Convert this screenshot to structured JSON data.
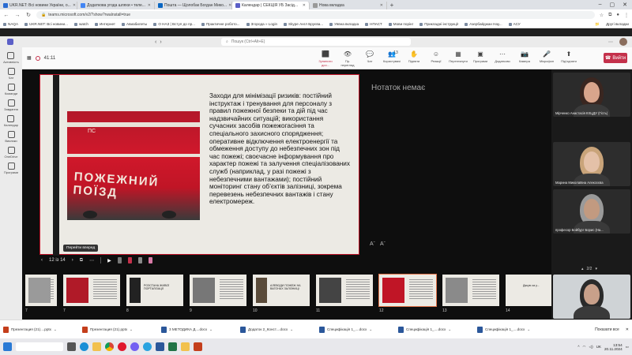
{
  "browser": {
    "tabs": [
      {
        "label": "UKR.NET: Всі новини України, о...",
        "color": "#2a6bd1",
        "active": false
      },
      {
        "label": "Додаткова угода шляхи • теле...",
        "color": "#4285f4",
        "active": false
      },
      {
        "label": "Пошта — Щолобак Богдан Мико...",
        "color": "#0a66c2",
        "active": false
      },
      {
        "label": "Календар | СЕКЦІЯ УБ Засід...",
        "color": "#5b5fc7",
        "active": true
      },
      {
        "label": "Нова вкладка",
        "color": "#999999",
        "active": false
      }
    ],
    "url": "teams.microsoft.com/v2/?show?rwalnstall=true",
    "bookmarks": [
      "NAQA",
      "UKR.NET: Всі новини...",
      "watch",
      "Интернет",
      "Авиабилеты",
      "О НАЗ | Вступ до пр...",
      "Практичне робото...",
      "Згорода » Login",
      "Skype Англ Бруєва...",
      "Уявна вкладка",
      "НПАСТ",
      "Мови порінг",
      "Прикладні інструкції",
      "Азербайджан Нау...",
      "АСУ"
    ],
    "bookmarks_right": "Другі вкладки"
  },
  "teams": {
    "search_placeholder": "Пошук (Ctrl+Alt+E)",
    "meeting_time": "41:11",
    "tools": [
      {
        "label": "Зупинити доо...",
        "icon": "⬛",
        "red": true
      },
      {
        "label": "Пр. перегляд",
        "icon": "👁",
        "red": false
      },
      {
        "label": "Чат",
        "icon": "💬",
        "red": false
      },
      {
        "label": "Користувачі",
        "icon": "👥",
        "badge": "13",
        "red": false
      },
      {
        "label": "Підняти",
        "icon": "✋",
        "red": false
      },
      {
        "label": "Реакції",
        "icon": "☺",
        "red": false
      },
      {
        "label": "Переглянути",
        "icon": "▦",
        "red": false
      },
      {
        "label": "Програми",
        "icon": "▣",
        "red": false
      },
      {
        "label": "Додатково",
        "icon": "⋯",
        "red": false
      },
      {
        "label": "Камера",
        "icon": "📷",
        "red": false
      },
      {
        "label": "Мікрофон",
        "icon": "🎤",
        "red": false
      },
      {
        "label": "Під’єднати",
        "icon": "⬆",
        "red": false
      }
    ],
    "leave_label": "Вийти",
    "rail": [
      "Активність",
      "Чат",
      "Команди",
      "Завдання",
      "Календар",
      "Виклики",
      "OneDrive",
      "Програми"
    ]
  },
  "slide": {
    "photo_label": "ПОЖЕЖНИЙ ПОЇЗД",
    "photo_number": "ПС",
    "text": "Заходи для мінімізації ризиків: постійний інструктаж і тренування для персоналу з правил пожежної безпеки та дій під час надзвичайних ситуацій; використання сучасних засобів пожежогасіння та спеціального захисного спорядження; оперативне відключення електроенергії та обмеження доступу до небезпечних зон під час пожежі; своєчасне інформування про характер пожежі та залучення спеціалізованих служб (наприклад, у разі пожежі з небезпечними вантажами); постійний моніторинг стану об’єктів залізниці, зокрема перевезень небезпечних вантажів і стану електромереж."
  },
  "presenter": {
    "notes": "Нотаток немає",
    "font_decrease": "Aˉ",
    "font_increase": "Aˉ",
    "tooltip": "Перейти вперед",
    "counter": "12 із 14",
    "thumbs": [
      {
        "num": "7",
        "text": ""
      },
      {
        "num": "7",
        "text": ""
      },
      {
        "num": "8",
        "text": "РОЗСТАНА ЖИВОЇ ПОРТАЛІЗАЦІЇ"
      },
      {
        "num": "9",
        "text": ""
      },
      {
        "num": "10",
        "text": "АЛЕВОДИ ПОЖЕЖ НА ВАГОНАХ ЗАЛІЗНИЦІ"
      },
      {
        "num": "11",
        "text": ""
      },
      {
        "num": "12",
        "text": ""
      },
      {
        "num": "13",
        "text": ""
      },
      {
        "num": "14",
        "text": "Дякую за у..."
      }
    ]
  },
  "participants": [
    {
      "name": "Мірченко Анастасія КХЦДУ (Гість)",
      "face": "#d9a58c",
      "hair": "#3a2620"
    },
    {
      "name": "Марина Миколаївна Алексєєва",
      "face": "#e4c1a8",
      "hair": "#c9a47a"
    },
    {
      "name": "професор Бойбург Борис (На...",
      "face": "#c29a80",
      "hair": "#9a9a9a"
    },
    {
      "name": "",
      "face": "#c8a08a",
      "hair": "#2a2a2a"
    }
  ],
  "pager": "2/2",
  "downloads": [
    {
      "label": "Презентация (21)....pptx",
      "color": "#c43e1c"
    },
    {
      "label": "Презентация (21).pptx",
      "color": "#c43e1c"
    },
    {
      "label": "3 МЕТОДИКА Д....docx",
      "color": "#2b579a"
    },
    {
      "label": "Додаток 2_Конст....docx",
      "color": "#2b579a"
    },
    {
      "label": "Специфікація 1_....docx",
      "color": "#2b579a"
    },
    {
      "label": "Специфікація 1_....docx",
      "color": "#2b579a"
    },
    {
      "label": "Специфікація 1_....docx",
      "color": "#2b579a"
    }
  ],
  "downloads_show_all": "Показати все",
  "taskbar": {
    "lang": "UK",
    "time": "13:54",
    "date": "20.11.2024"
  }
}
